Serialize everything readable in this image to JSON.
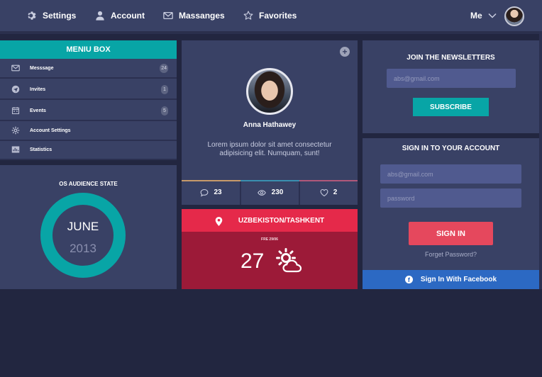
{
  "nav": {
    "items": [
      {
        "label": "Settings",
        "icon": "gear-icon"
      },
      {
        "label": "Account",
        "icon": "user-icon"
      },
      {
        "label": "Massanges",
        "icon": "envelope-icon"
      },
      {
        "label": "Favorites",
        "icon": "star-icon"
      }
    ],
    "user_label": "Me"
  },
  "menu_box": {
    "title": "MENIU BOX",
    "items": [
      {
        "label": "Messsage",
        "icon": "envelope-icon",
        "badge": "24"
      },
      {
        "label": "Invites",
        "icon": "send-icon",
        "badge": "1"
      },
      {
        "label": "Events",
        "icon": "calendar-icon",
        "badge": "5"
      },
      {
        "label": "Account Settings",
        "icon": "gear-icon",
        "badge": ""
      },
      {
        "label": "Statistics",
        "icon": "chart-icon",
        "badge": ""
      }
    ]
  },
  "audience": {
    "title": "OS AUDIENCE STATE",
    "month": "JUNE",
    "year": "2013",
    "ring_color": "#08a5a6"
  },
  "profile": {
    "name": "Anna Hathawey",
    "bio": "Lorem ipsum dolor sit amet consectetur adipisicing elit. Numquam, sunt!",
    "stats": {
      "comments": "23",
      "views": "230",
      "likes": "2"
    },
    "stat_colors": [
      "#c79a6a",
      "#3a8fb0",
      "#b0587a"
    ]
  },
  "weather": {
    "location": "UZBEKISTON/TASHKENT",
    "date": "FRE 29/06",
    "temperature": "27",
    "icon": "sun-cloud-icon"
  },
  "newsletter": {
    "title": "JOIN THE NEWSLETTERS",
    "email_placeholder": "abs@gmail.com",
    "subscribe_label": "SUBSCRIBE"
  },
  "signin": {
    "title": "SIGN IN TO YOUR ACCOUNT",
    "email_placeholder": "abs@gmail.com",
    "password_placeholder": "password",
    "button_label": "SIGN IN",
    "forgot_label": "Forget Password?",
    "facebook_label": "Sign In With Facebook"
  },
  "colors": {
    "background": "#222640",
    "panel": "#394165",
    "teal": "#08a5a6",
    "red": "#e5294a",
    "facebook": "#2c69c3"
  }
}
